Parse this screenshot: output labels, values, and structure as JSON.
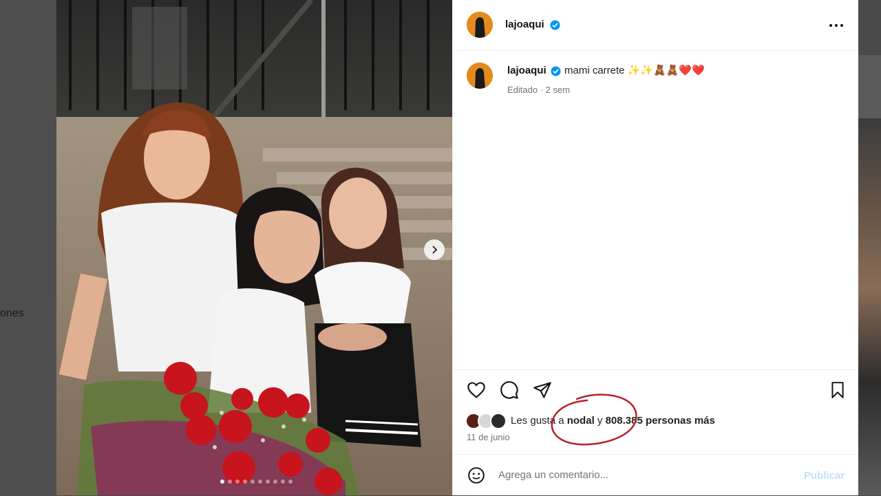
{
  "backdrop": {
    "left_text": "ones"
  },
  "post": {
    "author": "lajoaqui",
    "caption": "mami carrete ✨✨🧸🧸❤️❤️",
    "caption_author": "lajoaqui",
    "meta": "Editado · 2 sem",
    "likes_prefix": "Les gusta a ",
    "likes_user": "nodal",
    "likes_middle": " y ",
    "likes_count": "808.385 personas más",
    "date": "11 de junio",
    "comment_placeholder": "Agrega un comentario...",
    "publish_label": "Publicar",
    "carousel_total": 10,
    "carousel_active": 1
  },
  "colors": {
    "verified": "#0095f6",
    "avatar": "#e58a1f",
    "annotation": "#b5232a",
    "publish_disabled": "#c0dffd"
  },
  "icons": [
    "more-options-icon",
    "heart-icon",
    "comment-icon",
    "share-icon",
    "bookmark-icon",
    "emoji-icon",
    "chevron-right-icon",
    "verified-badge-icon"
  ]
}
